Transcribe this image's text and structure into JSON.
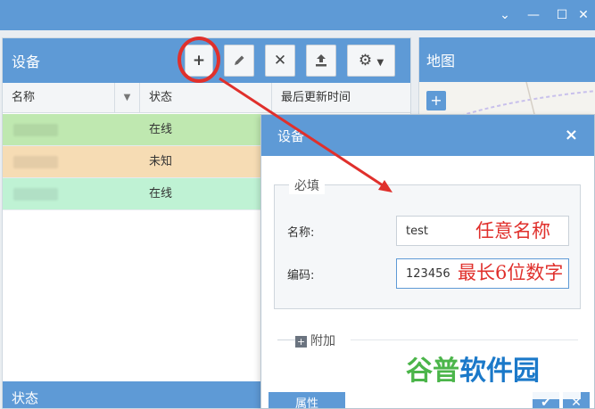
{
  "devices_panel": {
    "title": "设备",
    "toolbar": {
      "add_icon": "plus-icon",
      "edit_icon": "pencil-icon",
      "delete_icon": "x-icon",
      "upload_icon": "upload-icon",
      "settings_icon": "gear-icon"
    },
    "columns": [
      "名称",
      "状态",
      "最后更新时间"
    ],
    "rows": [
      {
        "status": "在线",
        "color": "#bfe8b0"
      },
      {
        "status": "未知",
        "color": "#f6dcb4"
      },
      {
        "status": "在线",
        "color": "#bff2d4"
      }
    ]
  },
  "state_panel": {
    "title": "状态"
  },
  "map_panel": {
    "title": "地图",
    "zoom_in": "+"
  },
  "dialog": {
    "title": "设备",
    "close": "×",
    "required_legend": "必填",
    "name_label": "名称:",
    "name_value": "test",
    "code_label": "编码:",
    "code_value": "123456",
    "extra_label": "附加",
    "properties_button": "属性"
  },
  "annotations": {
    "name_hint": "任意名称",
    "code_hint": "最长6位数字"
  },
  "watermark": {
    "text_green": "谷普",
    "text_blue": "软件园"
  },
  "colors": {
    "header_blue": "#5e9ad6",
    "annotation_red": "#e0302c"
  }
}
